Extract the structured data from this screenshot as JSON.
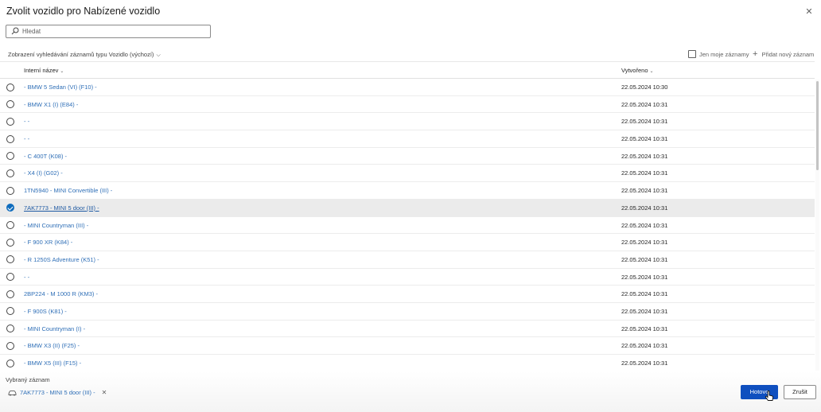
{
  "dialog": {
    "title": "Zvolit vozidlo pro Nabízené vozidlo",
    "close_icon": "close-icon"
  },
  "search": {
    "placeholder": "Hledat",
    "value": ""
  },
  "toolbar": {
    "view_label": "Zobrazení vyhledávání záznamů typu Vozidlo (výchozí)",
    "only_mine_label": "Jen moje záznamy",
    "only_mine_checked": false,
    "add_new_label": "Přidat nový záznam"
  },
  "grid": {
    "columns": {
      "name": "Interní název",
      "created": "Vytvořeno"
    },
    "rows": [
      {
        "name": "- BMW 5 Sedan (VI) (F10) -",
        "created": "22.05.2024 10:30",
        "selected": false
      },
      {
        "name": "- BMW X1 (I) (E84) -",
        "created": "22.05.2024 10:31",
        "selected": false
      },
      {
        "name": "- -",
        "created": "22.05.2024 10:31",
        "selected": false
      },
      {
        "name": "- -",
        "created": "22.05.2024 10:31",
        "selected": false
      },
      {
        "name": "- C 400T (K08) -",
        "created": "22.05.2024 10:31",
        "selected": false
      },
      {
        "name": "- X4 (I) (G02) -",
        "created": "22.05.2024 10:31",
        "selected": false
      },
      {
        "name": "1TN5940 - MINI Convertible (III) -",
        "created": "22.05.2024 10:31",
        "selected": false
      },
      {
        "name": "7AK7773 - MINI 5 door (III) -",
        "created": "22.05.2024 10:31",
        "selected": true
      },
      {
        "name": "- MINI Countryman (III) -",
        "created": "22.05.2024 10:31",
        "selected": false
      },
      {
        "name": "- F 900 XR (K84) -",
        "created": "22.05.2024 10:31",
        "selected": false
      },
      {
        "name": "- R 1250S Adventure (K51) -",
        "created": "22.05.2024 10:31",
        "selected": false
      },
      {
        "name": "- -",
        "created": "22.05.2024 10:31",
        "selected": false
      },
      {
        "name": "2BP224 - M 1000 R (KM3) -",
        "created": "22.05.2024 10:31",
        "selected": false
      },
      {
        "name": "- F 900S (K81) -",
        "created": "22.05.2024 10:31",
        "selected": false
      },
      {
        "name": "- MINI Countryman (I) -",
        "created": "22.05.2024 10:31",
        "selected": false
      },
      {
        "name": "- BMW X3 (II) (F25) -",
        "created": "22.05.2024 10:31",
        "selected": false
      },
      {
        "name": "- BMW X5 (III) (F15) -",
        "created": "22.05.2024 10:31",
        "selected": false
      }
    ]
  },
  "footer": {
    "selected_title": "Vybraný záznam",
    "selected_item": "7AK7773 - MINI 5 door (III) -",
    "done_label": "Hotovo",
    "cancel_label": "Zrušit"
  },
  "colors": {
    "accent": "#0f4fbf",
    "link": "#2f6fb7",
    "selected_row": "#ebebeb"
  }
}
